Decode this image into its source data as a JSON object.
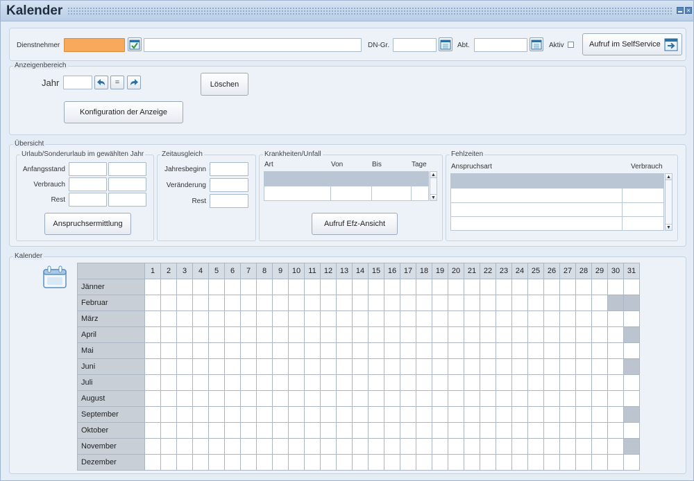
{
  "window": {
    "title": "Kalender"
  },
  "header": {
    "dienstnehmer_label": "Dienstnehmer",
    "dienstnehmer_id": "",
    "dienstnehmer_name": "",
    "dngr_label": "DN-Gr.",
    "dngr_value": "",
    "abt_label": "Abt.",
    "abt_value": "",
    "aktiv_label": "Aktiv",
    "aktiv_checked": false,
    "selfservice_button": "Aufruf im SelfService"
  },
  "anzeigenbereich": {
    "legend": "Anzeigenbereich",
    "jahr_label": "Jahr",
    "jahr_value": "",
    "equal_label": "=",
    "loeschen_button": "Löschen",
    "konfiguration_button": "Konfiguration der Anzeige"
  },
  "uebersicht": {
    "legend": "Übersicht",
    "urlaub": {
      "legend": "Urlaub/Sonderurlaub im gewählten Jahr",
      "rows": [
        "Anfangsstand",
        "Verbrauch",
        "Rest"
      ],
      "button": "Anspruchsermittlung"
    },
    "zeitausgleich": {
      "legend": "Zeitausgleich",
      "rows": [
        "Jahresbeginn",
        "Veränderung",
        "Rest"
      ]
    },
    "krankheiten": {
      "legend": "Krankheiten/Unfall",
      "columns": [
        "Art",
        "Von",
        "Bis",
        "Tage"
      ],
      "button": "Aufruf Efz-Ansicht"
    },
    "fehlzeiten": {
      "legend": "Fehlzeiten",
      "columns": [
        "Anspruchsart",
        "Verbrauch"
      ]
    }
  },
  "kalender": {
    "legend": "Kalender",
    "days": [
      "1",
      "2",
      "3",
      "4",
      "5",
      "6",
      "7",
      "8",
      "9",
      "10",
      "11",
      "12",
      "13",
      "14",
      "15",
      "16",
      "17",
      "18",
      "19",
      "20",
      "21",
      "22",
      "23",
      "24",
      "25",
      "26",
      "27",
      "28",
      "29",
      "30",
      "31"
    ],
    "months": [
      {
        "name": "Jänner",
        "days_in_month": 31
      },
      {
        "name": "Februar",
        "days_in_month": 29
      },
      {
        "name": "März",
        "days_in_month": 31
      },
      {
        "name": "April",
        "days_in_month": 30
      },
      {
        "name": "Mai",
        "days_in_month": 31
      },
      {
        "name": "Juni",
        "days_in_month": 30
      },
      {
        "name": "Juli",
        "days_in_month": 31
      },
      {
        "name": "August",
        "days_in_month": 31
      },
      {
        "name": "September",
        "days_in_month": 30
      },
      {
        "name": "Oktober",
        "days_in_month": 31
      },
      {
        "name": "November",
        "days_in_month": 30
      },
      {
        "name": "Dezember",
        "days_in_month": 31
      }
    ]
  },
  "colors": {
    "accent_orange": "#f8a95c",
    "disabled_day": "#bcc5cf",
    "selected_row": "#bac6d4"
  },
  "icons": {
    "dn_lookup": "calendar-check-icon",
    "dngr_lookup": "calendar-list-icon",
    "abt_lookup": "calendar-list-icon",
    "selfservice": "calendar-arrow-icon",
    "year_prev": "arrow-left-icon",
    "year_next": "arrow-right-icon",
    "kalender": "calendar-icon"
  }
}
